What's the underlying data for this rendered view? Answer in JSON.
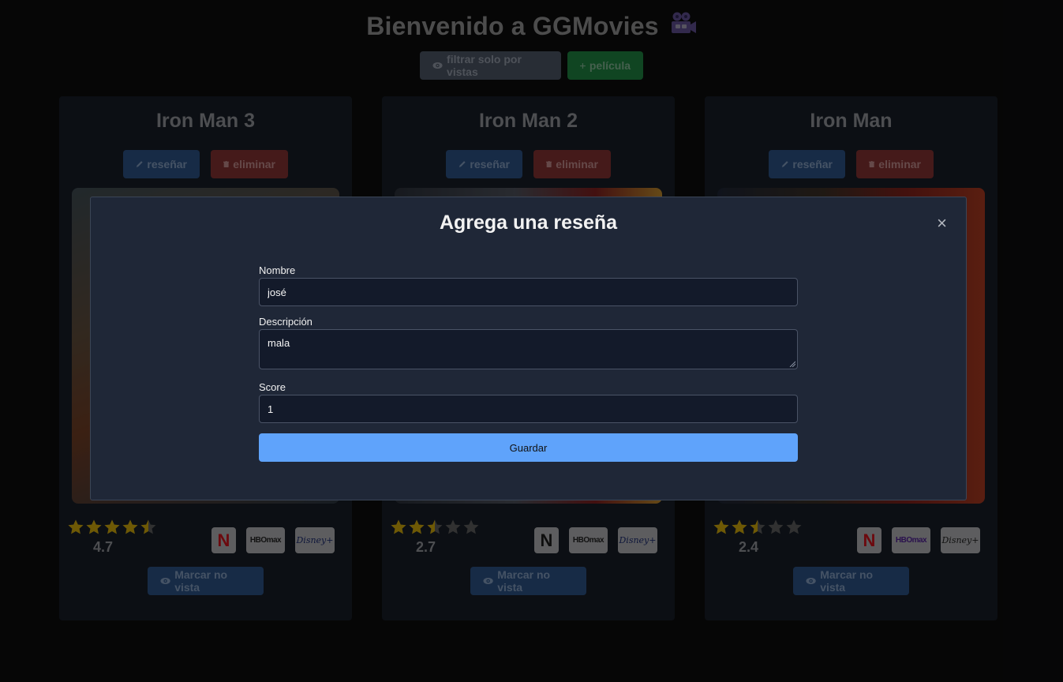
{
  "header": {
    "title": "Bienvenido a GGMovies",
    "title_icon": "movie-camera-icon",
    "filter_label": "filtrar solo por vistas",
    "add_label": "película"
  },
  "cards": [
    {
      "title": "Iron Man 3",
      "review_label": "reseñar",
      "delete_label": "eliminar",
      "rating": 4.7,
      "score_text": "4.7",
      "platforms": [
        "netflix",
        "hbo max",
        "disney+"
      ],
      "mark_label": "Marcar no vista"
    },
    {
      "title": "Iron Man 2",
      "review_label": "reseñar",
      "delete_label": "eliminar",
      "rating": 2.7,
      "score_text": "2.7",
      "platforms": [
        "netflix",
        "hbo max",
        "disney+"
      ],
      "mark_label": "Marcar no vista"
    },
    {
      "title": "Iron Man",
      "review_label": "reseñar",
      "delete_label": "eliminar",
      "rating": 2.4,
      "score_text": "2.4",
      "platforms": [
        "netflix",
        "hbo max",
        "disney+"
      ],
      "mark_label": "Marcar no vista"
    }
  ],
  "platform_labels": {
    "netflix": "N",
    "hbo": "HBOmax",
    "disney": "Disney+"
  },
  "modal": {
    "title": "Agrega una reseña",
    "close": "×",
    "name_label": "Nombre",
    "name_value": "josé",
    "desc_label": "Descripción",
    "desc_value": "mala",
    "score_label": "Score",
    "score_value": "1",
    "save_label": "Guardar"
  },
  "colors": {
    "star_on": "#c9a20a",
    "star_off": "#5a5a5a",
    "netflix_red": "#c5121a",
    "primary": "#5fa3fb"
  }
}
